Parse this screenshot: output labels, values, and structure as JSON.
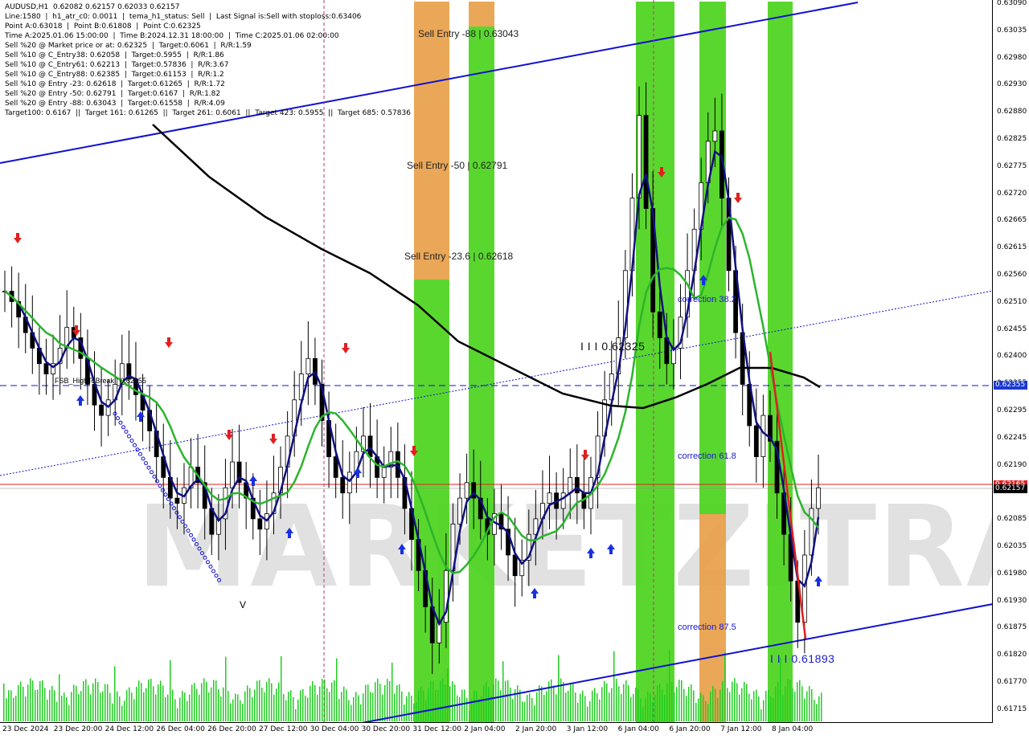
{
  "info_lines": [
    "AUDUSD,H1  0.62082 0.62157 0.62033 0.62157",
    "Line:1580  |  h1_atr_c0: 0.0011  |  tema_h1_status: Sell  |  Last Signal is:Sell with stoploss:0.63406",
    "Point A:0.63018  |  Point B:0.61808  |  Point C:0.62325",
    "Time A:2025.01.06 15:00:00  |  Time B:2024.12.31 18:00:00  |  Time C:2025.01.06 02:00:00",
    "Sell %20 @ Market price or at: 0.62325  |  Target:0.6061  |  R/R:1.59",
    "Sell %10 @ C_Entry38: 0.62058  |  Target:0.5955  |  R/R:1.86",
    "Sell %10 @ C_Entry61: 0.62213  |  Target:0.57836  |  R/R:3.67",
    "Sell %10 @ C_Entry88: 0.62385  |  Target:0.61153  |  R/R:1.2",
    "Sell %10 @ Entry -23: 0.62618  |  Target:0.61265  |  R/R:1.72",
    "Sell %20 @ Entry -50: 0.62791  |  Target:0.6167  |  R/R:1.82",
    "Sell %20 @ Entry -88: 0.63043  |  Target:0.61558  |  R/R:4.09",
    "Target100: 0.6167  ||  Target 161: 0.61265  ||  Target 261: 0.6061  ||  Target 423: 0.5955  ||  Target 685: 0.57836"
  ],
  "annotations": {
    "sell_entry_88": "Sell Entry -88 | 0.63043",
    "sell_entry_50": "Sell Entry -50 | 0.62791",
    "sell_entry_23": "Sell Entry -23.6 | 0.62618",
    "correction_38": "correction 38.2",
    "correction_61": "correction 61.8",
    "correction_87": "correction 87.5",
    "level_c": "I I I 0.62325",
    "level_b": "I I I 0.61893",
    "fsb_label": "FSB_HighToBreak | 0.62355",
    "v_mark": "V"
  },
  "watermark": "MARKETZITRADE",
  "price_axis": {
    "ticks": [
      "0.63090",
      "0.63035",
      "0.62980",
      "0.62930",
      "0.62880",
      "0.62825",
      "0.62775",
      "0.62720",
      "0.62665",
      "0.62615",
      "0.62560",
      "0.62510",
      "0.62455",
      "0.62400",
      "0.62355",
      "0.62295",
      "0.62245",
      "0.62190",
      "0.62140",
      "0.62085",
      "0.62035",
      "0.61980",
      "0.61930",
      "0.61875",
      "0.61820",
      "0.61770",
      "0.61715"
    ],
    "badge_blue": "0.62355",
    "badge_red": "0.62165",
    "badge_black": "0.62157"
  },
  "time_axis": [
    "23 Dec 2024",
    "23 Dec 20:00",
    "24 Dec 12:00",
    "26 Dec 04:00",
    "26 Dec 20:00",
    "27 Dec 12:00",
    "30 Dec 04:00",
    "30 Dec 20:00",
    "31 Dec 12:00",
    "2 Jan 04:00",
    "2 Jan 20:00",
    "3 Jan 12:00",
    "6 Jan 04:00",
    "6 Jan 20:00",
    "7 Jan 12:00",
    "8 Jan 04:00"
  ],
  "colors": {
    "zone_orange": "#e8a04a",
    "zone_green": "#4cd41c",
    "trend_blue": "#1010d0",
    "ma_black": "#000000",
    "ma_green": "#2bb52b",
    "ma_navy": "#101080",
    "price_red": "#e02020",
    "candle": "#000000",
    "volume": "#22cc22"
  },
  "chart_data": {
    "type": "candlestick",
    "symbol": "AUDUSD",
    "timeframe": "H1",
    "ohlc_last": {
      "open": 0.62082,
      "high": 0.62157,
      "low": 0.62033,
      "close": 0.62157
    },
    "ylim": [
      0.6171,
      0.631
    ],
    "levels": [
      {
        "name": "FSB_HighToBreak",
        "value": 0.62355
      },
      {
        "name": "current",
        "value": 0.62157
      },
      {
        "name": "red line",
        "value": 0.62165
      },
      {
        "name": "Point C",
        "value": 0.62325
      },
      {
        "name": "Point B label",
        "value": 0.61893
      }
    ],
    "zones": [
      {
        "label": "Sell Entry -88",
        "value": 0.63043
      },
      {
        "label": "Sell Entry -50",
        "value": 0.62791
      },
      {
        "label": "Sell Entry -23.6",
        "value": 0.62618
      }
    ],
    "close_series": [
      0.6254,
      0.6252,
      0.6249,
      0.6246,
      0.6243,
      0.624,
      0.6238,
      0.624,
      0.6243,
      0.6247,
      0.6245,
      0.6241,
      0.6236,
      0.6232,
      0.623,
      0.6233,
      0.6236,
      0.624,
      0.6237,
      0.6234,
      0.6231,
      0.6227,
      0.6222,
      0.6218,
      0.6214,
      0.6213,
      0.6216,
      0.622,
      0.6217,
      0.6212,
      0.6207,
      0.621,
      0.6216,
      0.6221,
      0.6217,
      0.6214,
      0.621,
      0.6208,
      0.6211,
      0.6215,
      0.622,
      0.6226,
      0.6233,
      0.6238,
      0.6241,
      0.6236,
      0.6229,
      0.6222,
      0.6218,
      0.6215,
      0.6219,
      0.6223,
      0.6226,
      0.6222,
      0.6218,
      0.622,
      0.6223,
      0.6218,
      0.6212,
      0.6206,
      0.62,
      0.6193,
      0.6186,
      0.619,
      0.62,
      0.6209,
      0.6214,
      0.6217,
      0.6214,
      0.621,
      0.6207,
      0.6211,
      0.6208,
      0.6203,
      0.6199,
      0.6202,
      0.6207,
      0.621,
      0.6213,
      0.6215,
      0.6212,
      0.6215,
      0.6218,
      0.6215,
      0.6212,
      0.6218,
      0.6226,
      0.6233,
      0.6238,
      0.6245,
      0.6258,
      0.6272,
      0.6288,
      0.627,
      0.625,
      0.6245,
      0.624,
      0.6243,
      0.6249,
      0.6258,
      0.6266,
      0.6275,
      0.6283,
      0.6285,
      0.6272,
      0.6258,
      0.6246,
      0.6236,
      0.6228,
      0.6222,
      0.623,
      0.6225,
      0.6215,
      0.6207,
      0.6198,
      0.619,
      0.6203,
      0.6212,
      0.6216
    ]
  }
}
